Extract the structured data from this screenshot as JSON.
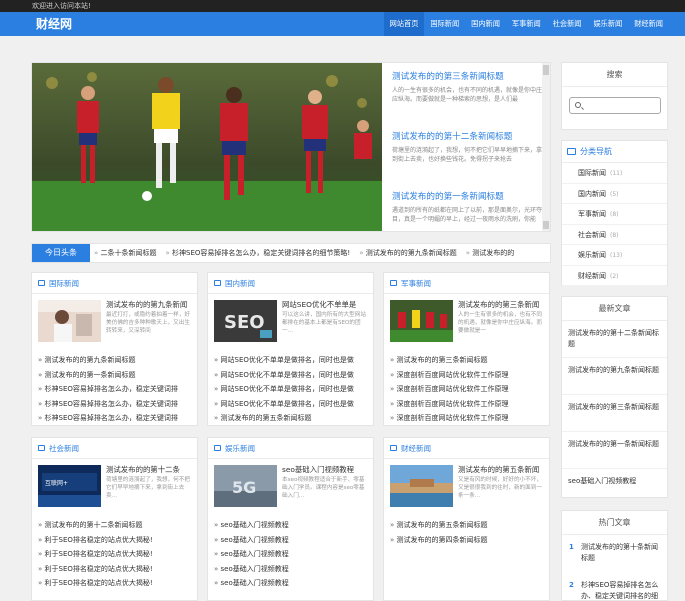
{
  "topbar": {
    "welcome": "欢迎进入访问本站!"
  },
  "header": {
    "logo": "财经网",
    "nav": [
      "网站首页",
      "国际新闻",
      "国内新闻",
      "军事新闻",
      "社会新闻",
      "娱乐新闻",
      "财经新闻"
    ]
  },
  "slider": {
    "items": [
      {
        "title": "测试发布的的第三条新闻标题",
        "desc": "人的一生有很多的机会，也有不同的机遇，就像是你中庄应纵海。而要做就是一种梯索的思想，是人们最"
      },
      {
        "title": "测试发布的的第十二条新闻标题",
        "desc": "荷塘里的涟漪起了，我想，何不把它们早早地摘下来，拿到街上去卖，也好换些钱花。免得拐子来抢去"
      },
      {
        "title": "测试发布的的第一条新闻标题",
        "desc": "遇道到的所有的纸都在网上了以前，那是面奥尔，光环夺目，真是一个明媚的早上，经过一夜雨水的洗刷，你能"
      }
    ]
  },
  "ticker": {
    "label": "今日头条",
    "items": [
      "二条十条新闻标题",
      "杉神SEO容易掉排名怎么办，稳定关键词排名的细节策略!",
      "测试发布的的第九条新闻标题",
      "测试发布的的"
    ]
  },
  "boxes": [
    {
      "title": "国际新闻",
      "feat_title": "测试发布的的第九条新闻",
      "feat_desc": "最近打打，或隐约着拍着一样，好美仿佛的吉多种种歌天上，又出生转转来，又深转间",
      "items": [
        "测试发布的的第九条新闻标题",
        "测试发布的的第一条新闻标题",
        "杉神SEO容易掉排名怎么办，稳定关键词排",
        "杉神SEO容易掉排名怎么办，稳定关键词排",
        "杉神SEO容易掉排名怎么办，稳定关键词排"
      ]
    },
    {
      "title": "国内新闻",
      "feat_title": "网站SEO优化不单单是",
      "feat_desc": "可以这么讲，国内所有的大型网站都排在的基本上都是有SEO的团一...",
      "items": [
        "网站SEO优化不单单是做排名，同时也是做",
        "网站SEO优化不单单是做排名，同时也是做",
        "网站SEO优化不单单是做排名，同时也是做",
        "网站SEO优化不单单是做排名，同时也是做",
        "测试发布的的第五条新闻标题"
      ]
    },
    {
      "title": "军事新闻",
      "feat_title": "测试发布的的第三条新闻",
      "feat_desc": "人的一生有很多的机会，也有不同的机遇，就像是你中庄应纵海。而要做就是一",
      "items": [
        "测试发布的的第三条新闻标题",
        "深度剖析百度网站优化软件工作原理",
        "深度剖析百度网站优化软件工作原理",
        "深度剖析百度网站优化软件工作原理",
        "深度剖析百度网站优化软件工作原理"
      ]
    },
    {
      "title": "社会新闻",
      "feat_title": "测试发布的的第十二条",
      "feat_desc": "荷塘里的涟漪起了，我想，何不把它们早早地摘下来，拿到街上去卖...",
      "items": [
        "测试发布的的第十二条新闻标题",
        "利于SEO排名稳定的站点优大揭秘!",
        "利于SEO排名稳定的站点优大揭秘!",
        "利于SEO排名稳定的站点优大揭秘!",
        "利于SEO排名稳定的站点优大揭秘!"
      ]
    },
    {
      "title": "娱乐新闻",
      "feat_title": "seo基础入门视频教程",
      "feat_desc": "本seo视频教程适合于新手、零基础入门学员。课程内容是seo零基础入门...",
      "items": [
        "seo基础入门视频教程",
        "seo基础入门视频教程",
        "seo基础入门视频教程",
        "seo基础入门视频教程",
        "seo基础入门视频教程"
      ]
    },
    {
      "title": "财经新闻",
      "feat_title": "测试发布的的第五条新闻",
      "feat_desc": "又是有风的时候，好好的小不坏，又是很很我到的往时，新的面到一条一条...",
      "items": [
        "测试发布的的第五条新闻标题",
        "测试发布的的第四条新闻标题"
      ]
    }
  ],
  "sidebar": {
    "search_title": "搜索",
    "search_placeholder": "",
    "categories_title": "分类导航",
    "categories": [
      {
        "name": "国际新闻",
        "count": "(11)"
      },
      {
        "name": "国内新闻",
        "count": "(5)"
      },
      {
        "name": "军事新闻",
        "count": "(8)"
      },
      {
        "name": "社会新闻",
        "count": "(8)"
      },
      {
        "name": "娱乐新闻",
        "count": "(13)"
      },
      {
        "name": "财经新闻",
        "count": "(2)"
      }
    ],
    "latest_title": "最新文章",
    "latest": [
      "测试发布的的第十二条新闻标题",
      "测试发布的的第九条新闻标题",
      "测试发布的的第三条新闻标题",
      "测试发布的的第一条新闻标题",
      "seo基础入门视频教程"
    ],
    "hot_title": "热门文章",
    "hot": [
      {
        "rank": "1",
        "title": "测试发布的的第十条新闻标题"
      },
      {
        "rank": "2",
        "title": "杉神SEO容易掉排名怎么办、稳定关键词排名的细节策"
      }
    ]
  },
  "colors": {
    "accent": "#2a7fe0",
    "topbar": "#222222",
    "background": "#f0f0f0"
  }
}
